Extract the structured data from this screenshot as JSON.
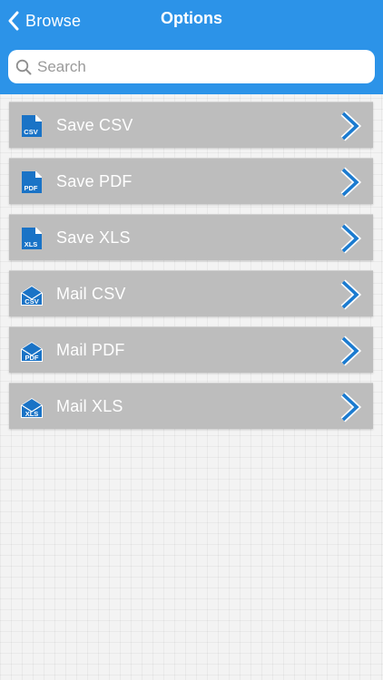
{
  "colors": {
    "nav_background": "#2c93e8",
    "row_background": "#bdbdbd",
    "icon_blue": "#1a73c6",
    "chevron_blue": "#1b7bd0"
  },
  "navbar": {
    "back_label": "Browse",
    "back_icon": "chevron-left-icon",
    "title": "Options"
  },
  "search": {
    "icon": "search-icon",
    "placeholder": "Search",
    "value": ""
  },
  "options": [
    {
      "label": "Save CSV",
      "icon": "save-file-icon",
      "badge": "CSV",
      "kind": "save"
    },
    {
      "label": "Save PDF",
      "icon": "save-file-icon",
      "badge": "PDF",
      "kind": "save"
    },
    {
      "label": "Save XLS",
      "icon": "save-file-icon",
      "badge": "XLS",
      "kind": "save"
    },
    {
      "label": "Mail CSV",
      "icon": "mail-file-icon",
      "badge": "CSV",
      "kind": "mail"
    },
    {
      "label": "Mail PDF",
      "icon": "mail-file-icon",
      "badge": "PDF",
      "kind": "mail"
    },
    {
      "label": "Mail XLS",
      "icon": "mail-file-icon",
      "badge": "XLS",
      "kind": "mail"
    }
  ]
}
